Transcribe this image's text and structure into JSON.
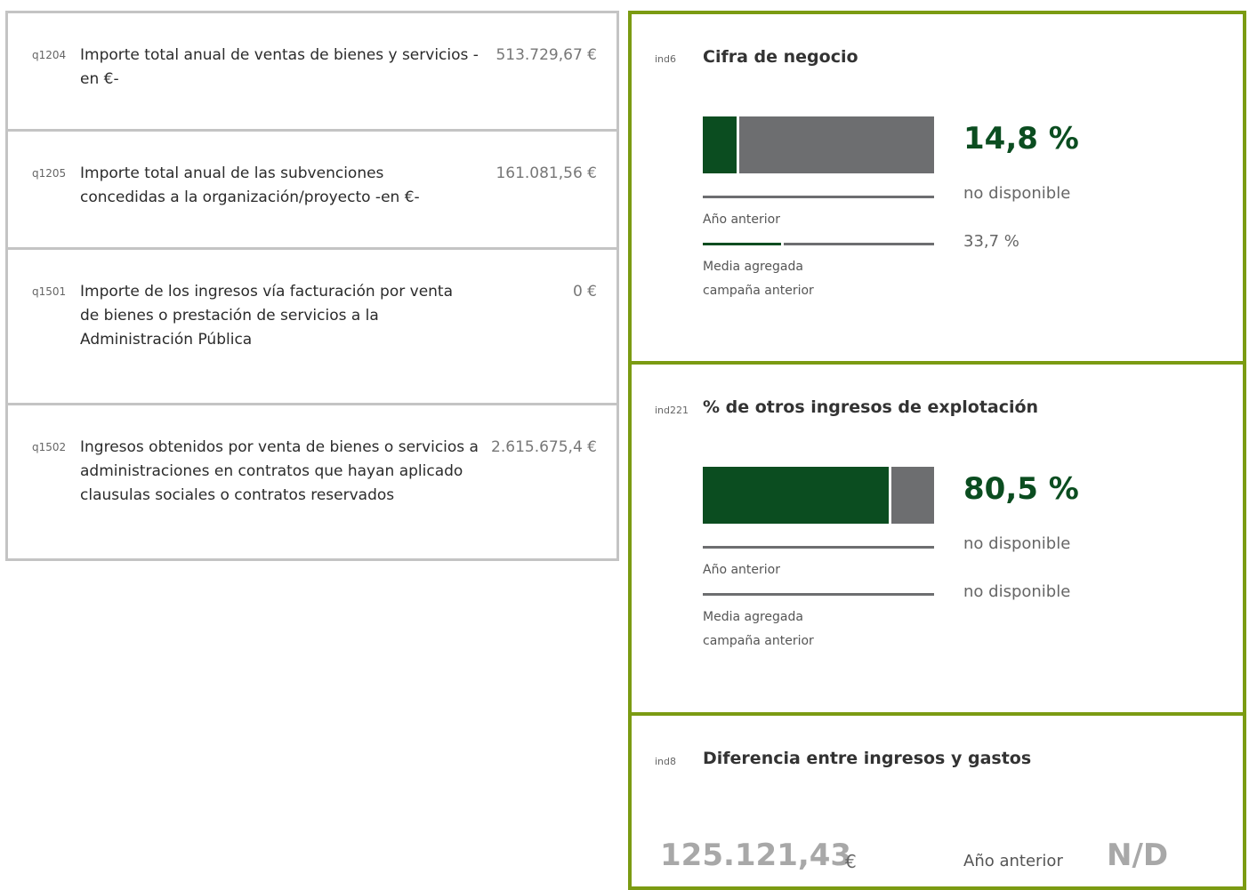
{
  "questions": [
    {
      "code": "q1204",
      "text": "Importe total anual de ventas de bienes y servicios -en €-",
      "value": "513.729,67 €"
    },
    {
      "code": "q1205",
      "text": "Importe total anual de las subvenciones concedidas a la organización/proyecto -en €-",
      "value": "161.081,56 €"
    },
    {
      "code": "q1501",
      "text": "Importe de los ingresos vía facturación por venta de bienes o prestación de servicios a la Administración Pública",
      "value": "0 €"
    },
    {
      "code": "q1502",
      "text": "Ingresos obtenidos por venta de bienes o servicios a administraciones en contratos que hayan aplicado clausulas sociales o contratos reservados",
      "value": "2.615.675,4 €"
    }
  ],
  "indicators": [
    {
      "code": "ind6",
      "title": "Cifra de negocio",
      "value": "14,8 %",
      "fraction": 0.148,
      "previous_year_label": "Año anterior",
      "previous_year_value": "no disponible",
      "aggregate_label_line1": "Media agregada",
      "aggregate_label_line2": "campaña anterior",
      "aggregate_value": "33,7 %",
      "aggregate_fraction": 0.337
    },
    {
      "code": "ind221",
      "title": "% de otros ingresos de explotación",
      "value": "80,5 %",
      "fraction": 0.805,
      "previous_year_label": "Año anterior",
      "previous_year_value": "no disponible",
      "aggregate_label_line1": "Media agregada",
      "aggregate_label_line2": "campaña anterior",
      "aggregate_value": "no disponible"
    },
    {
      "code": "ind8",
      "title": "Diferencia entre ingresos y gastos",
      "value": "125.121,43",
      "unit": "€",
      "previous_year_label": "Año anterior",
      "previous_year_value": "N/D"
    }
  ],
  "colors": {
    "accent_green": "#0b4d20",
    "border_olive": "#7b9b12",
    "bar_gray": "#6d6e70",
    "card_border_gray": "#c4c4c4"
  }
}
